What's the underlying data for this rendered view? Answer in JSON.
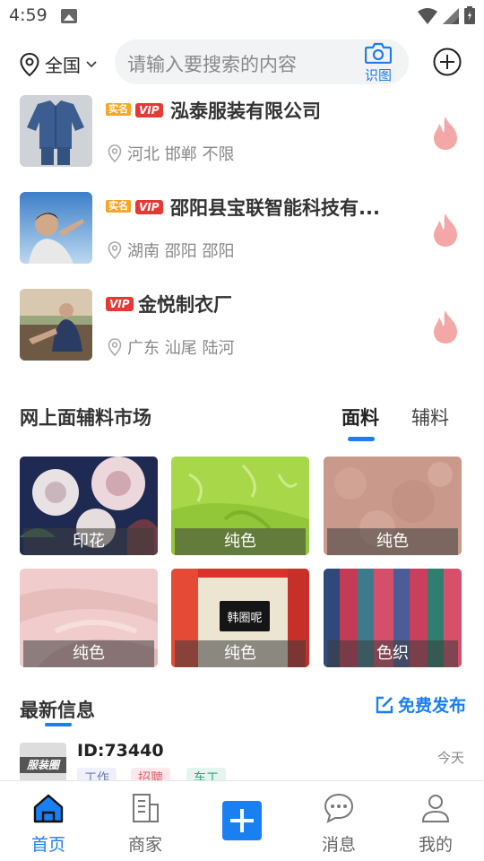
{
  "status_bar": {
    "time": "4:59"
  },
  "header": {
    "location": "全国",
    "search_placeholder": "请输入要搜索的内容",
    "scan_label": "识图"
  },
  "companies": [
    {
      "name": "泓泰服装有限公司",
      "location": "河北 邯郸 不限",
      "real_badge": "实名",
      "vip_badge": "VIP",
      "has_real": true
    },
    {
      "name": "邵阳县宝联智能科技有...",
      "location": "湖南 邵阳 邵阳",
      "real_badge": "实名",
      "vip_badge": "VIP",
      "has_real": true
    },
    {
      "name": "金悦制衣厂",
      "location": "广东 汕尾 陆河",
      "real_badge": "",
      "vip_badge": "VIP",
      "has_real": false
    }
  ],
  "market": {
    "title": "网上面辅料市场",
    "tabs": [
      "面料",
      "辅料"
    ],
    "active_tab": "面料",
    "tiles": [
      {
        "label": "印花"
      },
      {
        "label": "纯色"
      },
      {
        "label": "纯色"
      },
      {
        "label": "纯色"
      },
      {
        "label": "纯色",
        "inner_text": "韩圈呢"
      },
      {
        "label": "色织"
      }
    ]
  },
  "latest": {
    "title": "最新信息",
    "publish_label": "免费发布",
    "item": {
      "id": "ID:73440",
      "date": "今天",
      "thumb_text": "服装圈",
      "tags": [
        "工作",
        "招聘",
        "车工"
      ]
    }
  },
  "nav": {
    "items": [
      {
        "label": "首页",
        "active": true
      },
      {
        "label": "商家",
        "active": false
      },
      {
        "label": "消息",
        "active": false
      },
      {
        "label": "我的",
        "active": false
      }
    ]
  },
  "colors": {
    "accent": "#1a7ff0",
    "vip": "#e53935",
    "real": "#f6a623",
    "fire": "#f4a7a7"
  }
}
